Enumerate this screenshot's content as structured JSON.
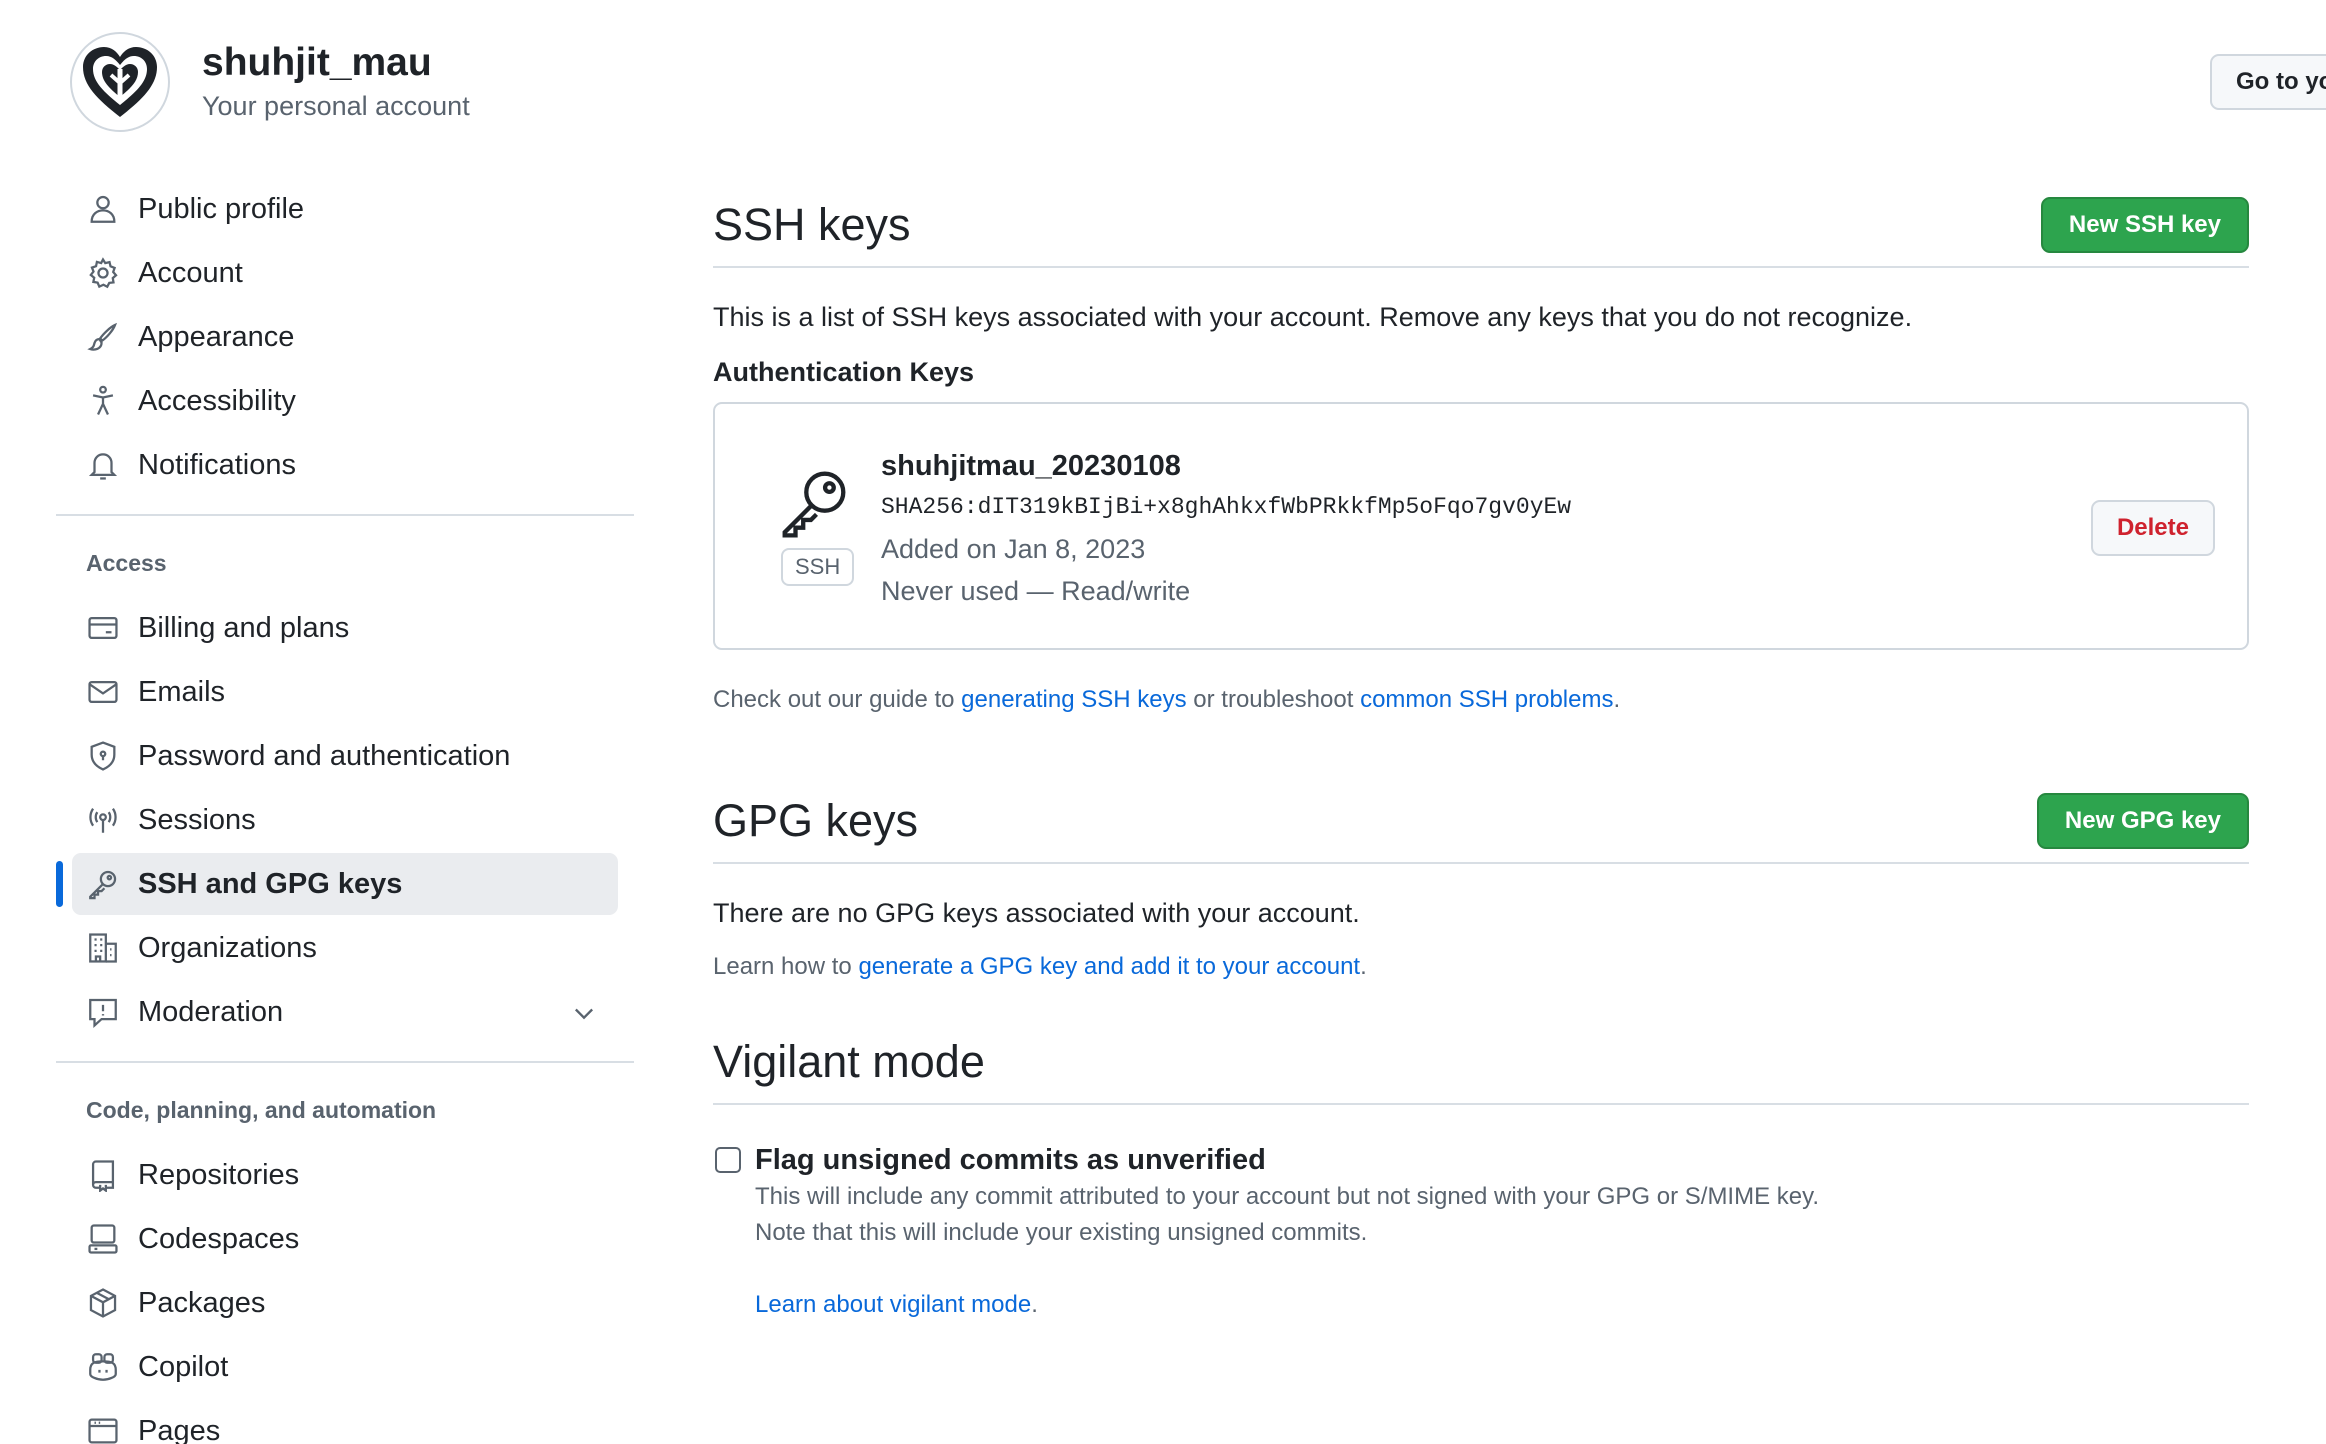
{
  "header": {
    "username": "shuhjit_mau",
    "subtitle": "Your personal account",
    "goto_button": "Go to yo"
  },
  "sidebar": {
    "items": [
      {
        "label": "Public profile",
        "icon": "person-icon"
      },
      {
        "label": "Account",
        "icon": "gear-icon"
      },
      {
        "label": "Appearance",
        "icon": "paintbrush-icon"
      },
      {
        "label": "Accessibility",
        "icon": "accessibility-icon"
      },
      {
        "label": "Notifications",
        "icon": "bell-icon"
      }
    ],
    "access_title": "Access",
    "access_items": [
      {
        "label": "Billing and plans",
        "icon": "credit-card-icon"
      },
      {
        "label": "Emails",
        "icon": "mail-icon"
      },
      {
        "label": "Password and authentication",
        "icon": "shield-lock-icon"
      },
      {
        "label": "Sessions",
        "icon": "broadcast-icon"
      },
      {
        "label": "SSH and GPG keys",
        "icon": "key-icon",
        "active": true
      },
      {
        "label": "Organizations",
        "icon": "organization-icon"
      },
      {
        "label": "Moderation",
        "icon": "report-icon"
      }
    ],
    "code_title": "Code, planning, and automation",
    "code_items": [
      {
        "label": "Repositories",
        "icon": "repo-icon"
      },
      {
        "label": "Codespaces",
        "icon": "codespaces-icon"
      },
      {
        "label": "Packages",
        "icon": "package-icon"
      },
      {
        "label": "Copilot",
        "icon": "copilot-icon"
      },
      {
        "label": "Pages",
        "icon": "browser-icon"
      }
    ]
  },
  "ssh": {
    "title": "SSH keys",
    "new_button": "New SSH key",
    "description": "This is a list of SSH keys associated with your account. Remove any keys that you do not recognize.",
    "auth_title": "Authentication Keys",
    "key": {
      "name": "shuhjitmau_20230108",
      "fingerprint": "SHA256:dIT319kBIjBi+x8ghAhkxfWbPRkkfMp5oFqo7gv0yEw",
      "added": "Added on Jan 8, 2023",
      "usage": "Never used — Read/write",
      "badge": "SSH",
      "delete_button": "Delete"
    },
    "guide_prefix": "Check out our guide to ",
    "guide_link1": "generating SSH keys",
    "guide_mid": " or troubleshoot ",
    "guide_link2": "common SSH problems",
    "guide_suffix": "."
  },
  "gpg": {
    "title": "GPG keys",
    "new_button": "New GPG key",
    "empty_text": "There are no GPG keys associated with your account.",
    "learn_prefix": "Learn how to ",
    "learn_link": "generate a GPG key and add it to your account",
    "learn_suffix": "."
  },
  "vigilant": {
    "title": "Vigilant mode",
    "checkbox_label": "Flag unsigned commits as unverified",
    "desc1": "This will include any commit attributed to your account but not signed with your GPG or S/MIME key.",
    "desc2": "Note that this will include your existing unsigned commits.",
    "learn_link": "Learn about vigilant mode",
    "learn_suffix": "."
  },
  "colors": {
    "accent": "#0969da",
    "green": "#2da44e",
    "danger": "#cf222e"
  }
}
